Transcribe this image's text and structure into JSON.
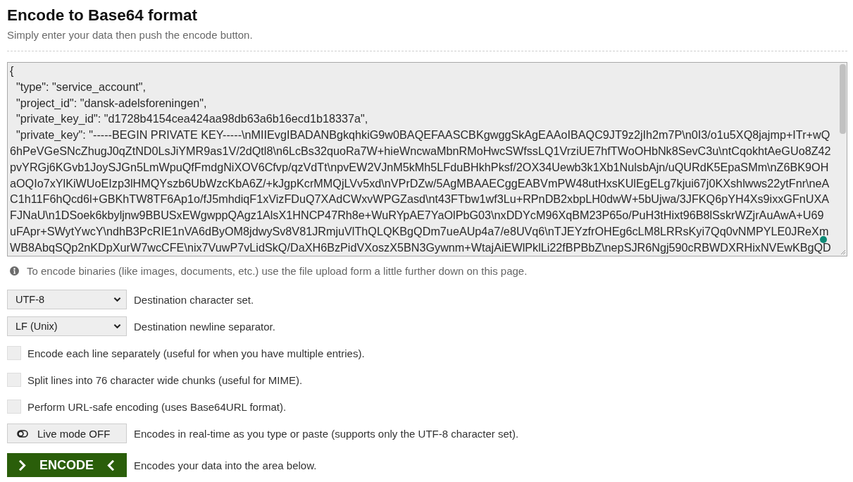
{
  "header": {
    "title": "Encode to Base64 format",
    "subtitle": "Simply enter your data then push the encode button."
  },
  "input": {
    "lines": [
      "{",
      "  \"type\": \"service_account\",",
      "  \"project_id\": \"dansk-adelsforeningen\",",
      "  \"private_key_id\": \"d1728b4154cea424aa98db63a6b16ecd1b18337a\",",
      "  \"private_key\": \"-----BEGIN PRIVATE KEY-----\\nMIIEvgIBADANBgkqhkiG9w0BAQEFAASCBKgwggSkAgEAAoIBAQC9JT9z2jIh2m7P\\n0I3/o1u5XQ8jajmp+ITr+wQ",
      "6hPeVGeSNcZhugJ0qZtND0LsJiYMR9as1V/2dQtl8\\n6LcBs32quoRa7W+hieWncwaMbnRMoHwcSWfssLQ1VrziUE7hfTWoOHbNk8SevC3u\\ntCqokhtAeGUo8Z42",
      "pvYRGj6KGvb1JoySJGn5LmWpuQfFmdgNiXOV6Cfvp/qzVdTt\\npvEW2VJnM5kMh5LFduBHkhPksf/2OX34Uewb3k1Xb1NulsbAjn/uQURdK5EpaSMm\\nZ6BK9OH",
      "aOQIo7xYlKiWUoEIzp3lHMQYszb6UbWzcKbA6Z/+kJgpKcrMMQjLVv5xd\\nVPrDZw/5AgMBAAECggEABVmPW48utHxsKUlEgELg7kjui67j0KXshlwws22ytFnr\\neA",
      "C1h11F6hQcd6l+GBKhTW8TF6Ap1o/fJ5mhdiqF1xVizFDuQ7XAdCWxvWPGZasd\\nt43FTbw1wf3Lu+RPnDB2xbpLH0dwW+5bUjwa/3JFKQ6pYH4Xs9ixxGFnUXA",
      "FJNaU\\n1DSoek6kbyljnw9BBUSxEWgwppQAgz1AlsX1HNCP47Rh8e+WuRYpAE7YaOlPbG03\\nxDDYcM96XqBM23P65o/PuH3tHixt96B8lSskrWZjrAuAwA+U69",
      "uFApr+SWytYwcY\\ndhB3PcRIE1nVA6dByOM8jdwySv8V81JRmjuVlThQLQKBgQDm7ueAUp4a7/e8UVq6\\nTJEYzfrOHEg6cLM8LRRsKyi7Qq0vNMPYLE0JReXm",
      "WB8AbqSQp2nKDpXurW7wcCFE\\nix7VuwP7vLidSkQ/DaXH6BzPidVXoszX5BN3Gywnm+WtajAiEWlPklLi22fBPBbZ\\nepSJR6Ngj590cRBWDXRHixNVEwKBgQD"
    ]
  },
  "info_note": "To encode binaries (like images, documents, etc.) use the file upload form a little further down on this page.",
  "options": [
    {
      "kind": "select",
      "value": "UTF-8",
      "description": "Destination character set."
    },
    {
      "kind": "select",
      "value": "LF (Unix)",
      "description": "Destination newline separator."
    },
    {
      "kind": "checkbox",
      "checked": false,
      "description": "Encode each line separately (useful for when you have multiple entries)."
    },
    {
      "kind": "checkbox",
      "checked": false,
      "description": "Split lines into 76 character wide chunks (useful for MIME)."
    },
    {
      "kind": "checkbox",
      "checked": false,
      "description": "Perform URL-safe encoding (uses Base64URL format)."
    },
    {
      "kind": "toggle",
      "text": "Live mode OFF",
      "on": false,
      "description": "Encodes in real-time as you type or paste (supports only the UTF-8 character set)."
    },
    {
      "kind": "submit",
      "text": "ENCODE",
      "description": "Encodes your data into the area below."
    }
  ]
}
